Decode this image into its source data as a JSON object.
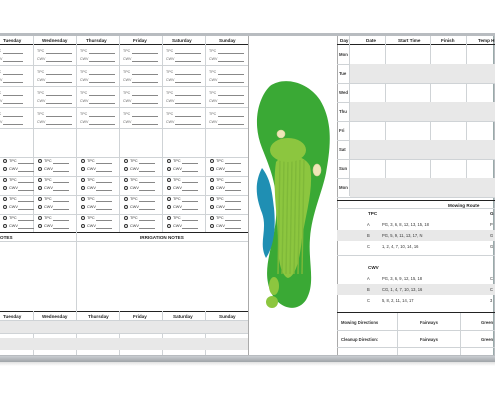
{
  "days_header": [
    "Tuesday",
    "Wednesday",
    "Thursday",
    "Friday",
    "Saturday",
    "Sunday"
  ],
  "mow_labels": {
    "tpc": "TPC",
    "cwv": "CWV"
  },
  "notes": {
    "left_title": "OTES",
    "irrigation_title": "IRRIGATION NOTES"
  },
  "bottom_days": [
    "Tuesday",
    "Wednesday",
    "Thursday",
    "Friday",
    "Saturday",
    "Sunday"
  ],
  "schedule": {
    "headers": [
      "Day",
      "Date",
      "Start Time",
      "Finish",
      "Temp H"
    ],
    "days": [
      "Mon",
      "Tue",
      "Wed",
      "Thu",
      "Fri",
      "Sat",
      "Sun",
      "Mon"
    ]
  },
  "mowing_route": {
    "title": "Mowing Route",
    "tpc": {
      "label": "TPC",
      "rows": [
        {
          "letter": "A",
          "holes": "PG, 3, 6, 8, 12, 13, 15, 18",
          "right": "P"
        },
        {
          "letter": "B",
          "holes": "PG, 5, 9, 11, 13, 17, N",
          "right": "G"
        },
        {
          "letter": "C",
          "holes": "1, 2, 4, 7, 10, 14, 16",
          "right": "G"
        }
      ],
      "right_header": "G"
    },
    "cwv": {
      "label": "CWV",
      "rows": [
        {
          "letter": "A",
          "holes": "PG, 3, 6, 9, 12, 15, 18",
          "right": "C"
        },
        {
          "letter": "B",
          "holes": "CG, 1, 4, 7, 10, 13, 16",
          "right": "C"
        },
        {
          "letter": "C",
          "holes": "5, 8, 2, 11, 14, 17",
          "right": "3"
        }
      ]
    },
    "directions": [
      {
        "label": "Mowing Directions",
        "col2": "Fairways",
        "col3": "Green"
      },
      {
        "label": "Cleanup Direction:",
        "col2": "Fairways",
        "col3": "Green"
      }
    ]
  },
  "colors": {
    "green": "#3aa935",
    "fairway": "#8cc63f",
    "water": "#1f8fb3",
    "sand": "#efe6b8"
  }
}
